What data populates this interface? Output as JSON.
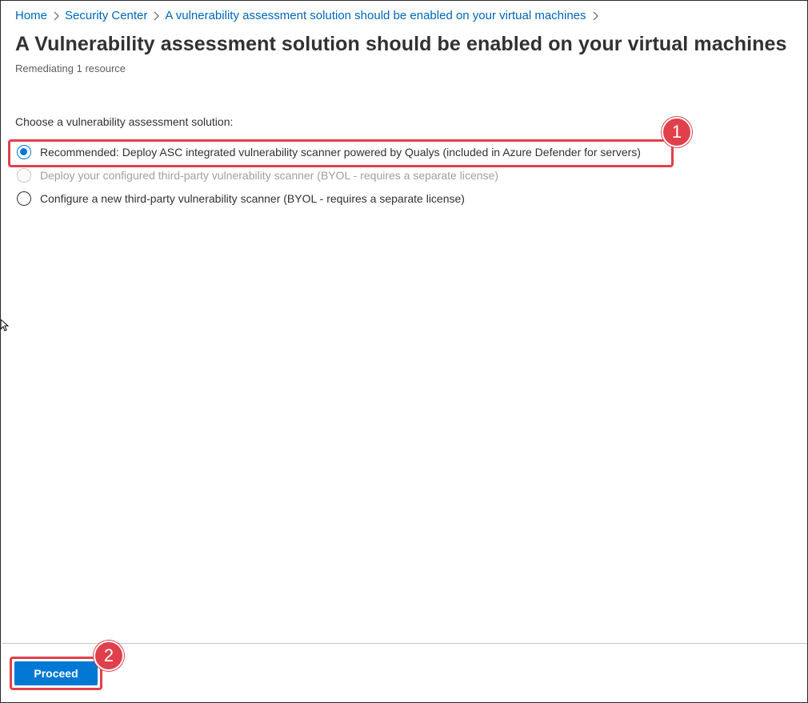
{
  "breadcrumb": {
    "items": [
      {
        "label": "Home"
      },
      {
        "label": "Security Center"
      },
      {
        "label": "A vulnerability assessment solution should be enabled on your virtual machines"
      }
    ],
    "separator_icon": "chevron-right-icon"
  },
  "header": {
    "title": "A Vulnerability assessment solution should be enabled on your virtual machines",
    "subtitle": "Remediating 1 resource"
  },
  "form": {
    "question": "Choose a vulnerability assessment solution:",
    "options": [
      {
        "label": "Recommended: Deploy ASC integrated vulnerability scanner powered by Qualys (included in Azure Defender for servers)",
        "selected": true,
        "disabled": false
      },
      {
        "label": "Deploy your configured third-party vulnerability scanner (BYOL - requires a separate license)",
        "selected": false,
        "disabled": true
      },
      {
        "label": "Configure a new third-party vulnerability scanner (BYOL - requires a separate license)",
        "selected": false,
        "disabled": false
      }
    ]
  },
  "footer": {
    "proceed_label": "Proceed"
  },
  "annotations": {
    "step1": "1",
    "step2": "2",
    "color": "#e0404b"
  },
  "colors": {
    "accent": "#0078d4",
    "link": "#0067b8"
  }
}
